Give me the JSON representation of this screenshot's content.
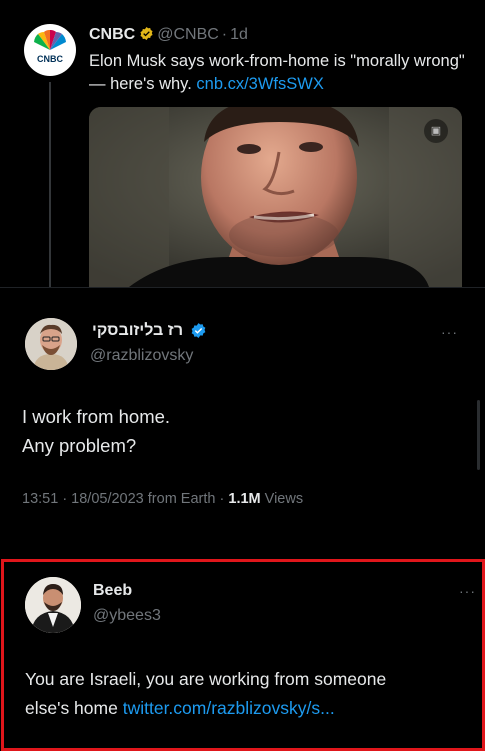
{
  "quoted_tweet": {
    "author_name": "CNBC",
    "handle": "@CNBC",
    "separator": "·",
    "time": "1d",
    "text": "Elon Musk says work-from-home is \"morally wrong\" — here's why.",
    "link": "cnb.cx/3WfsSWX",
    "avatar_logo": "CNBC",
    "verification": "gold-badge"
  },
  "main_tweet": {
    "author_name": "רז בליזובסקי",
    "handle": "@razblizovsky",
    "verification": "blue-badge",
    "text_line1": "I work from home.",
    "text_line2": "Any problem?",
    "timestamp": "13:51 · 18/05/2023 from Earth",
    "meta_separator": "·",
    "views_count": "1.1M",
    "views_label": "Views"
  },
  "reply": {
    "author_name": "Beeb",
    "handle": "@ybees3",
    "text": "You are Israeli, you are working from someone else's home",
    "text_line1": "You are Israeli, you are working from someone",
    "text_line2": "else's home",
    "link": "twitter.com/razblizovsky/s..."
  },
  "more_menu": "···",
  "colors": {
    "background": "#000000",
    "text": "#e7e9ea",
    "muted": "#71767b",
    "link": "#1d9bf0",
    "highlight": "#e0161b"
  }
}
